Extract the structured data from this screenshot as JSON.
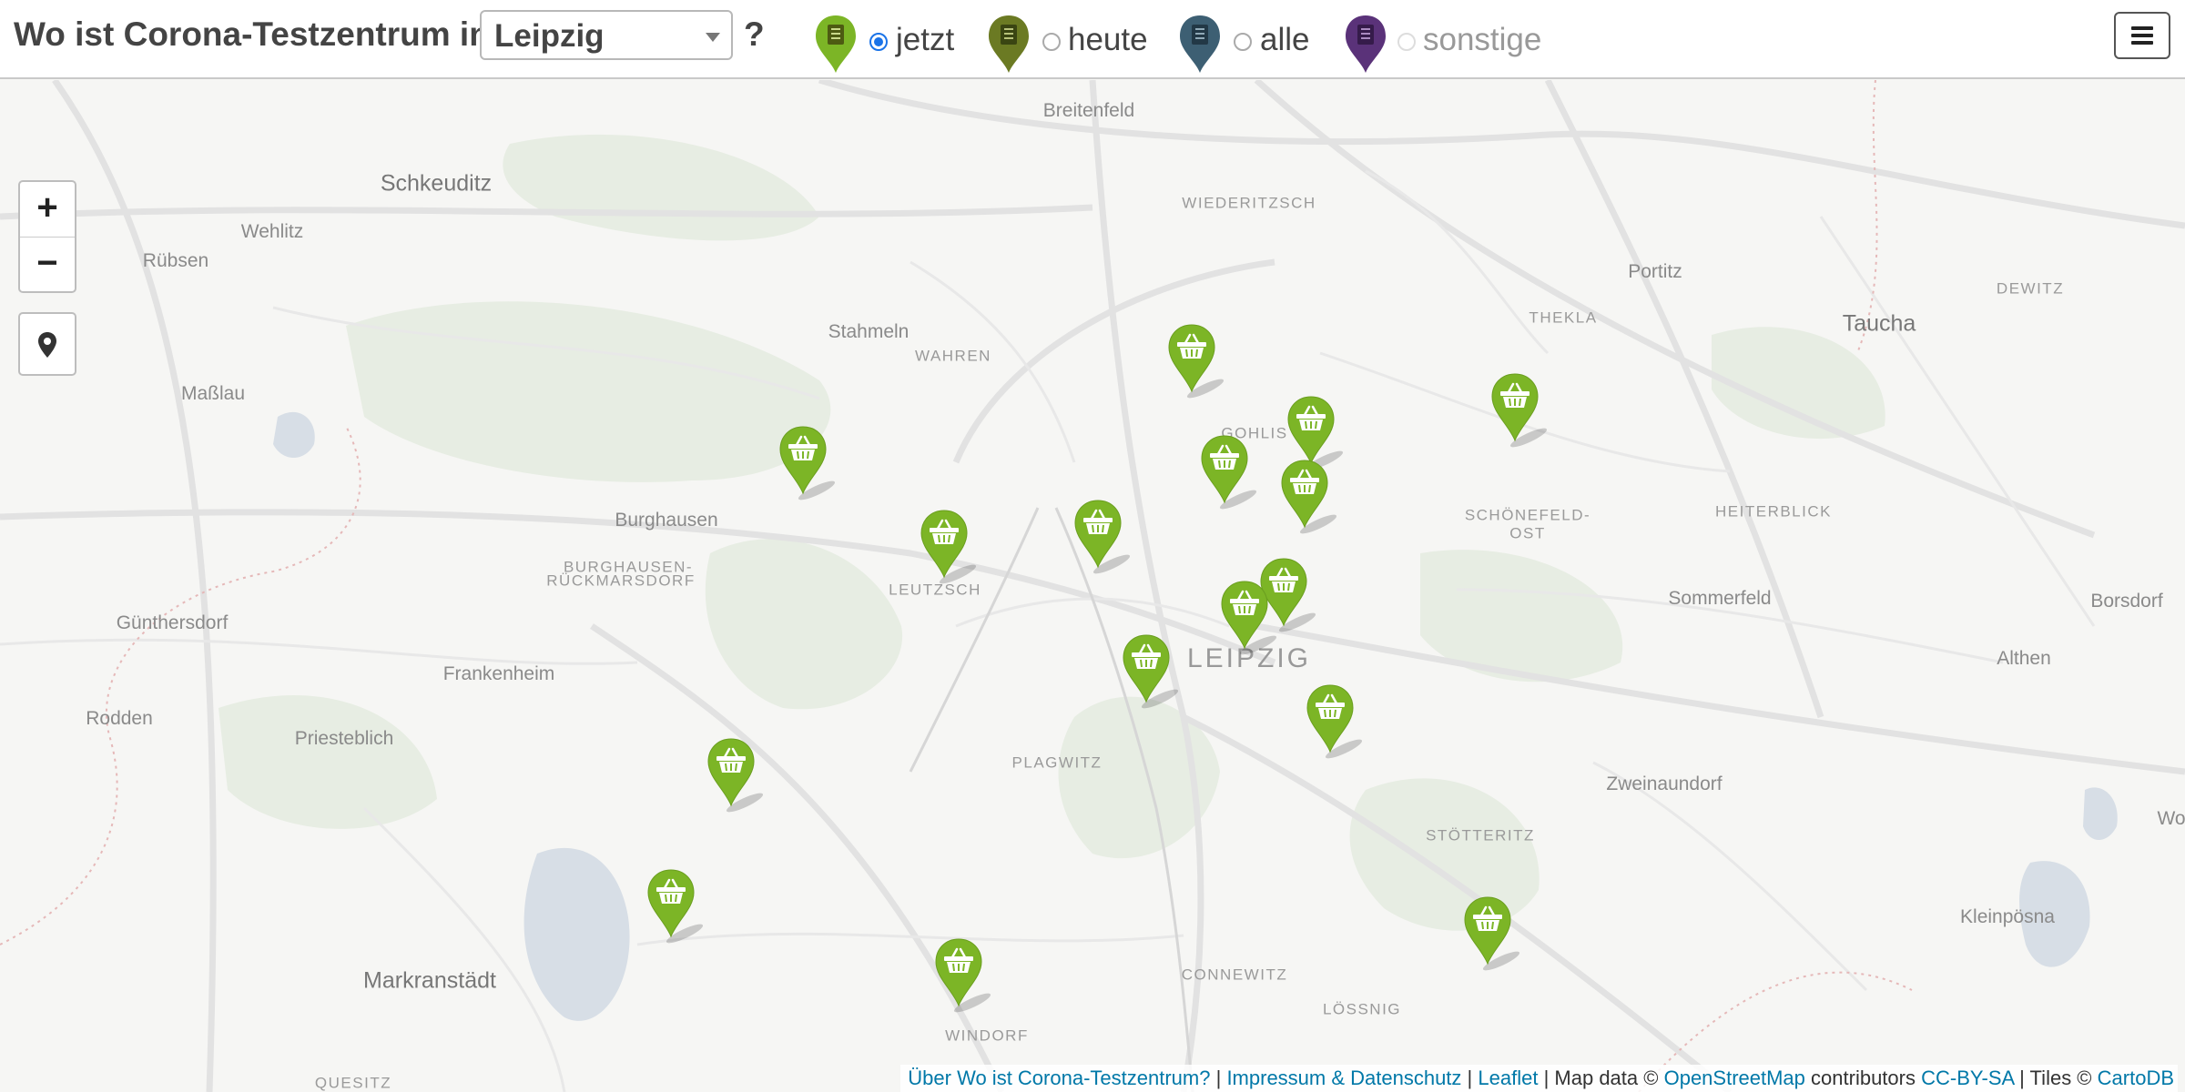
{
  "header": {
    "title": "Wo ist Corona-Testzentrum in",
    "city_selected": "Leipzig",
    "question_mark": "?",
    "menu_icon": "hamburger-menu-icon",
    "filters": [
      {
        "label": "jetzt",
        "selected": true,
        "color": "#7cb526"
      },
      {
        "label": "heute",
        "selected": false,
        "color": "#6b7a23"
      },
      {
        "label": "alle",
        "selected": false,
        "color": "#3d5f73"
      },
      {
        "label": "sonstige",
        "selected": false,
        "color": "#5a3279"
      }
    ]
  },
  "map_controls": {
    "zoom_in": "+",
    "zoom_out": "−",
    "locate_icon": "map-pin-icon"
  },
  "places": {
    "breitenfeld": "Breitenfeld",
    "schkeuditz": "Schkeuditz",
    "wiederitzsch": "WIEDERITZSCH",
    "wehlitz": "Wehlitz",
    "ruebsen": "Rübsen",
    "portitz": "Portitz",
    "dewitz": "DEWITZ",
    "taucha": "Taucha",
    "thekla": "THEKLA",
    "stahmeln": "Stahmeln",
    "wahren": "WAHREN",
    "masslau": "Maßlau",
    "gohlis": "GOHLIS",
    "schoenefeld_1": "SCHÖNEFELD-",
    "schoenefeld_2": "OST",
    "heiterblick": "HEITERBLICK",
    "burghausen": "Burghausen",
    "burghausen_r_1": "BURGHAUSEN-",
    "burghausen_r_2": "RÜCKMARSDORF",
    "leutzsch": "LEUTZSCH",
    "sommerfeld": "Sommerfeld",
    "borsdorf": "Borsdorf",
    "guenthersdorf": "Günthersdorf",
    "leipzig": "LEIPZIG",
    "althen": "Althen",
    "frankenheim": "Frankenheim",
    "rodden": "Rodden",
    "priesteblich": "Priesteblich",
    "plagwitz": "PLAGWITZ",
    "zweinaundorf": "Zweinaundorf",
    "stoetteritz": "STÖTTERITZ",
    "wo": "Wo",
    "kleinposna": "Kleinpösna",
    "markranstaedt": "Markranstädt",
    "connewitz": "CONNEWITZ",
    "loessnig": "LÖSSNIG",
    "windorf": "WINDORF",
    "quesitz": "QUESITZ"
  },
  "markers": {
    "icon": "shopping-basket-icon",
    "color": "#7cb526",
    "count": 17
  },
  "attribution": {
    "about": "Über Wo ist Corona-Testzentrum?",
    "sep1": "|",
    "impressum": "Impressum & Datenschutz",
    "sep2": "|",
    "leaflet": "Leaflet",
    "map_data_prefix": "| Map data ©",
    "osm": "OpenStreetMap",
    "contributors": "contributors",
    "license": "CC-BY-SA",
    "tiles_prefix": "| Tiles ©",
    "cartodb": "CartoDB"
  }
}
